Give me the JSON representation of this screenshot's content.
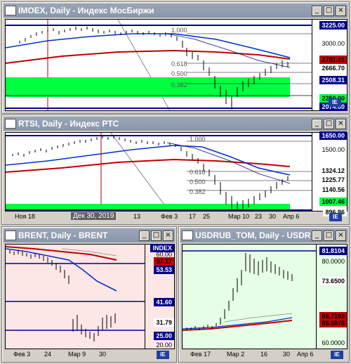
{
  "windows": {
    "imoex": {
      "title": "IMOEX, Daily - Индекс МосБиржи",
      "prices": [
        "3225.00",
        "3000.00",
        "2781.21",
        "2666.70",
        "2508.31",
        "2250.00",
        "2074.00"
      ],
      "fib": [
        "1.000",
        "0.618",
        "0.500",
        "0.382"
      ]
    },
    "rtsi": {
      "title": "RTSI, Daily - Индекс РТС",
      "prices": [
        "1650.00",
        "1500.00",
        "1324.12",
        "1225.77",
        "1140.56",
        "1007.46",
        "896.86",
        "805.78"
      ],
      "fib": [
        "1.000",
        "0.618",
        "0.500",
        "0.382"
      ],
      "dates": [
        "Ноя 18",
        "Дек 30, 2019",
        "13",
        "Фев 3",
        "17",
        "25",
        "Мар 10",
        "23",
        "30",
        "Апр 6"
      ]
    },
    "brent": {
      "title": "BRENT, Daily - BRENT",
      "index_label": "INDEX",
      "prices": [
        "60.00",
        "57.17",
        "53.53",
        "41.60",
        "31.79",
        "25.00",
        "20.00"
      ],
      "dates": [
        "Фев 3",
        "24",
        "Мар 9",
        "30"
      ]
    },
    "usdrub": {
      "title": "USDRUB_TOM, Daily - USDR",
      "prices": [
        "81.8104",
        "80.0000",
        "73.6500",
        "66.7193",
        "65.5078",
        "60.0000"
      ],
      "dates": [
        "Фев 17",
        "Мар 2",
        "16",
        "30",
        "Апр 6"
      ]
    }
  },
  "buttons": {
    "min": "_",
    "max": "□",
    "close": "×",
    "scroll": "IE"
  }
}
